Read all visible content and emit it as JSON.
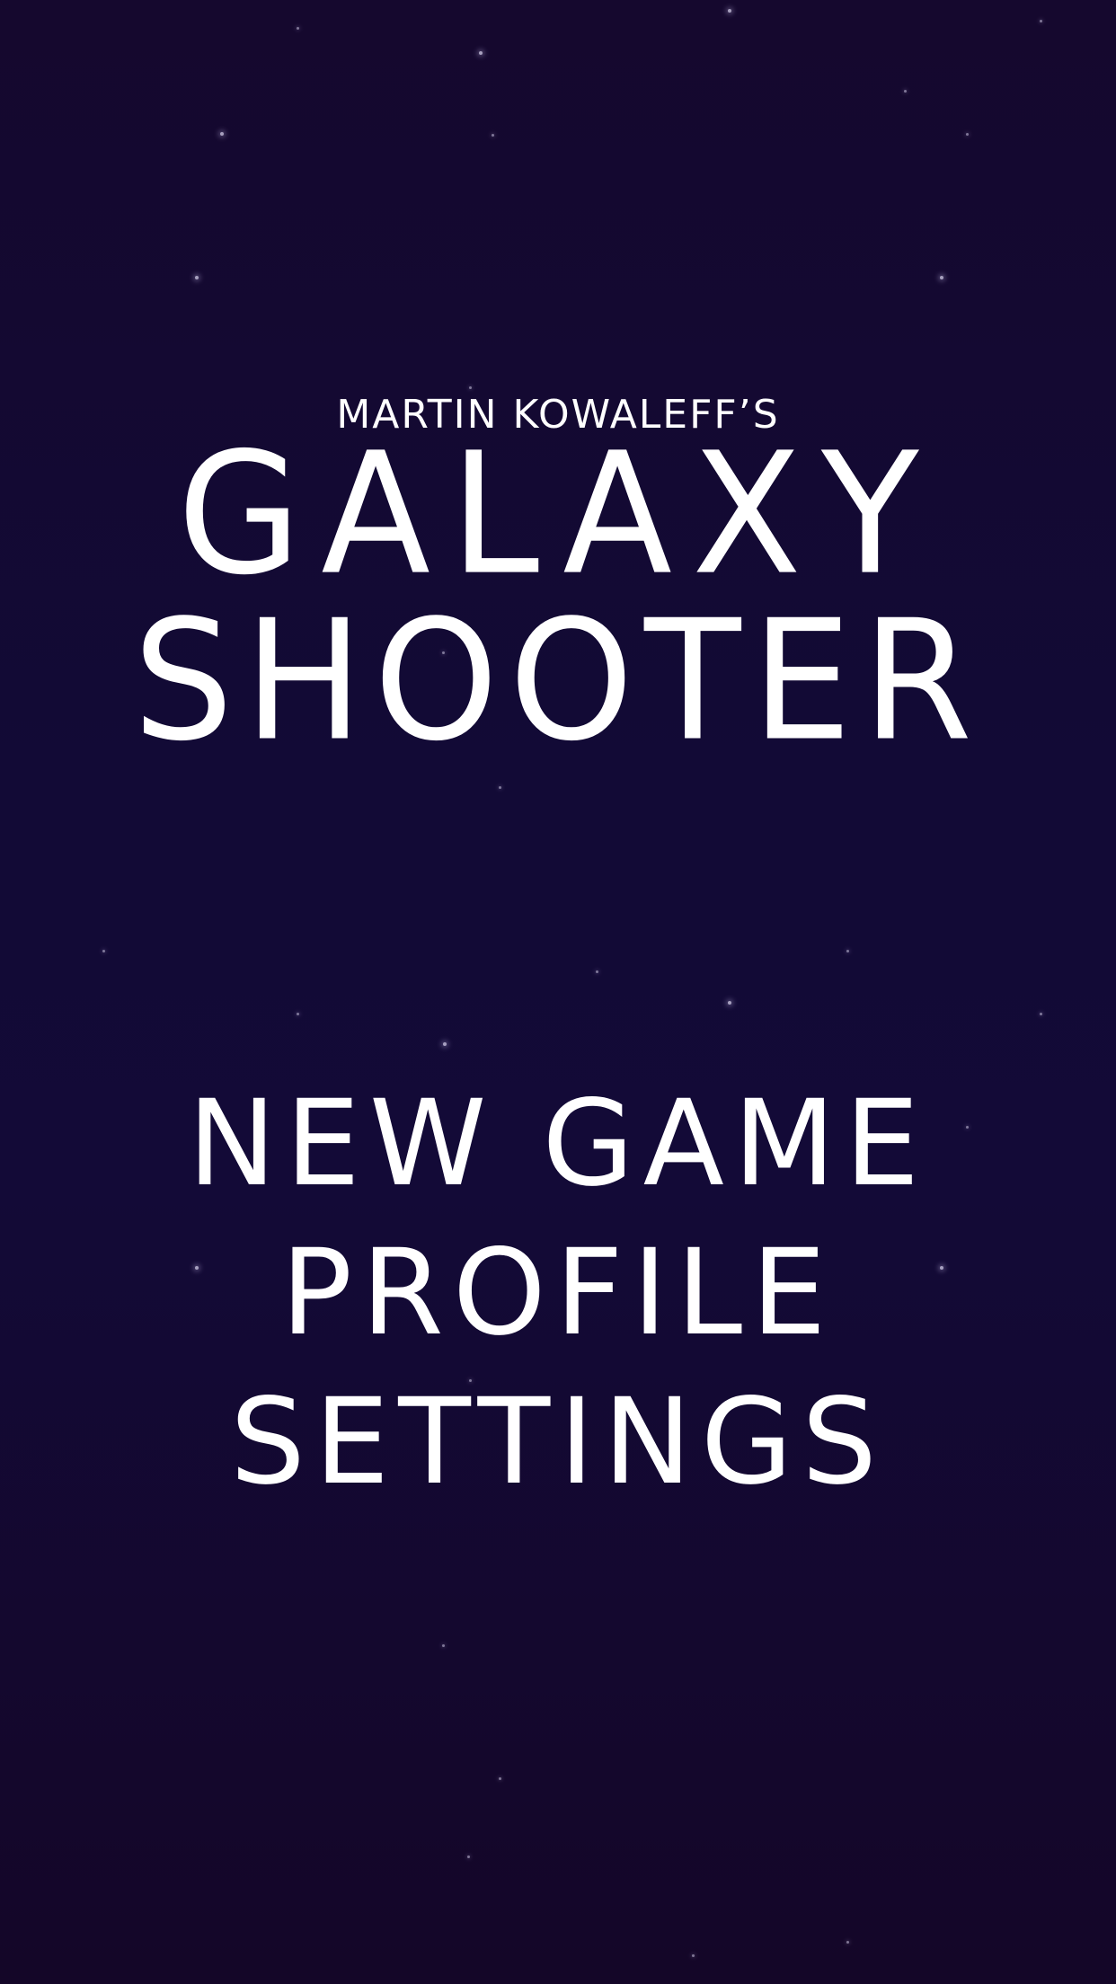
{
  "header": {
    "author": "MARTIN KOWALEFF’S",
    "title_line1": "GALAXY",
    "title_line2": "SHOOTER"
  },
  "menu": {
    "items": [
      {
        "label": "NEW GAME"
      },
      {
        "label": "PROFILE"
      },
      {
        "label": "SETTINGS"
      }
    ]
  },
  "colors": {
    "background_top": "#15082e",
    "background_mid": "#120a36",
    "background_bottom": "#140628",
    "text": "#ffffff",
    "star": "#d9d3ee"
  }
}
